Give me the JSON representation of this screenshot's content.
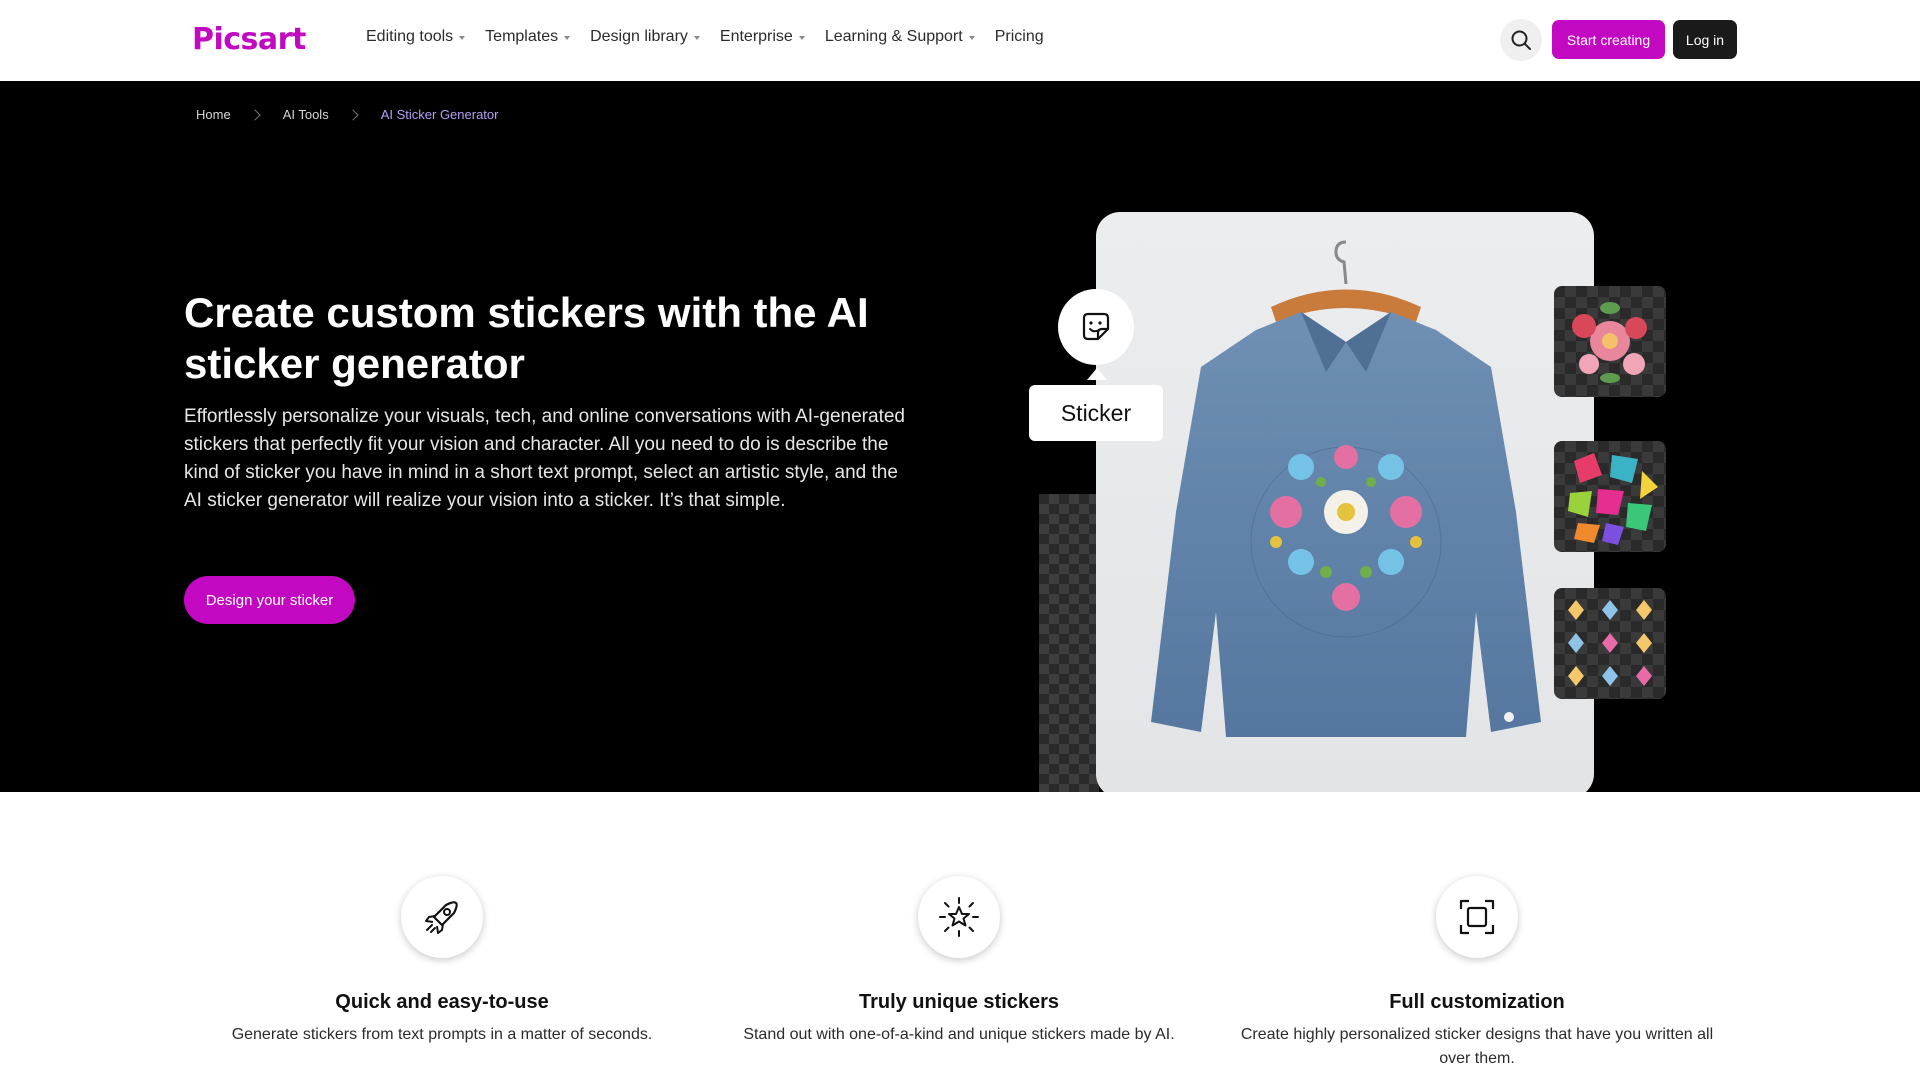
{
  "brand": {
    "name": "Picsart",
    "accent": "#c209c1"
  },
  "nav": {
    "items": [
      {
        "label": "Editing tools",
        "has_dropdown": true
      },
      {
        "label": "Templates",
        "has_dropdown": true
      },
      {
        "label": "Design library",
        "has_dropdown": true
      },
      {
        "label": "Enterprise",
        "has_dropdown": true
      },
      {
        "label": "Learning & Support",
        "has_dropdown": true
      },
      {
        "label": "Pricing",
        "has_dropdown": false
      }
    ],
    "search_icon": "search-icon",
    "start_label": "Start creating",
    "login_label": "Log in"
  },
  "breadcrumb": [
    "Home",
    "AI Tools",
    "AI Sticker Generator"
  ],
  "hero": {
    "title": "Create custom stickers with the AI sticker generator",
    "description": "Effortlessly personalize your visuals, tech, and online conversations with AI-generated stickers that perfectly fit your vision and character. All you need to do is describe the kind of sticker you have in mind in a short text prompt, select an artistic style, and the AI sticker generator will realize your vision into a sticker. It’s that simple.",
    "cta_label": "Design your sticker",
    "sticker_tag": "Sticker",
    "sticker_icon": "sticker-icon",
    "image": "denim-jacket-embroidered-flowers",
    "thumbnails": [
      "floral-sticker-thumbnail",
      "colorful-gems-sticker-thumbnail",
      "pattern-stickers-thumbnail"
    ]
  },
  "features": [
    {
      "icon": "rocket-icon",
      "title": "Quick and easy-to-use",
      "desc": "Generate stickers from text prompts in a matter of seconds."
    },
    {
      "icon": "sparkle-star-icon",
      "title": "Truly unique stickers",
      "desc": "Stand out with one-of-a-kind and unique stickers made by AI."
    },
    {
      "icon": "crop-frame-icon",
      "title": "Full customization",
      "desc": "Create highly personalized sticker designs that have you written all over them."
    }
  ]
}
